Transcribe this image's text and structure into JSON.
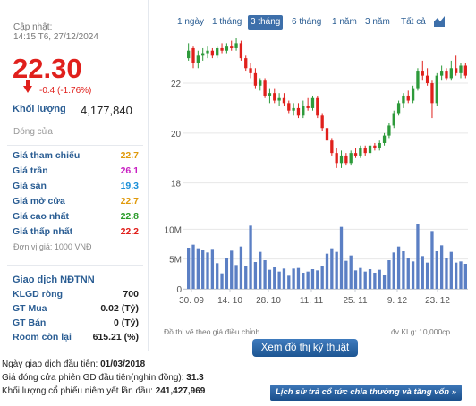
{
  "quote": {
    "updated_label": "Cập nhật:",
    "updated_time": "14:15 T6, 27/12/2024",
    "price": "22.30",
    "change": "-0.4 (-1.76%)",
    "volume_label": "Khối lượng",
    "volume_value": "4,177,840",
    "session_status": "Đóng cửa"
  },
  "price_levels": [
    {
      "label": "Giá tham chiếu",
      "value": "22.7",
      "color": "#e09a0c"
    },
    {
      "label": "Giá trần",
      "value": "26.1",
      "color": "#c81fc2"
    },
    {
      "label": "Giá sàn",
      "value": "19.3",
      "color": "#1a8fd8"
    },
    {
      "label": "Giá mở cửa",
      "value": "22.7",
      "color": "#e09a0c"
    },
    {
      "label": "Giá cao nhất",
      "value": "22.8",
      "color": "#2a9b2a"
    },
    {
      "label": "Giá thấp nhất",
      "value": "22.2",
      "color": "#e0201c"
    }
  ],
  "unit_note": "Đơn vị giá: 1000 VNĐ",
  "foreign": {
    "title": "Giao dịch NĐTNN",
    "rows": [
      {
        "label": "KLGD ròng",
        "value": "700"
      },
      {
        "label": "GT Mua",
        "value": "0.02 (Tỷ)"
      },
      {
        "label": "GT Bán",
        "value": "0 (Tỷ)"
      },
      {
        "label": "Room còn lại",
        "value": "615.21 (%)"
      }
    ]
  },
  "range_tabs": [
    {
      "label": "1 ngày",
      "active": false
    },
    {
      "label": "1 tháng",
      "active": false
    },
    {
      "label": "3 tháng",
      "active": true
    },
    {
      "label": "6 tháng",
      "active": false
    },
    {
      "label": "1 năm",
      "active": false
    },
    {
      "label": "3 năm",
      "active": false
    },
    {
      "label": "Tất cả",
      "active": false
    }
  ],
  "chart_type_icon": "area-chart-icon",
  "chart_data": {
    "type": "candlestick",
    "price_ticks": [
      "22",
      "20",
      "18"
    ],
    "price_range": [
      17.7,
      23.9
    ],
    "volume_ticks": [
      "10M",
      "5M",
      "0"
    ],
    "volume_range": [
      0,
      12
    ],
    "x_tick_labels": [
      "30. 09",
      "14. 10",
      "28. 10",
      "11. 11",
      "25. 11",
      "9. 12",
      "23. 12"
    ],
    "candles": [
      {
        "o": 23.0,
        "h": 23.6,
        "l": 22.9,
        "c": 23.3
      },
      {
        "o": 23.4,
        "h": 23.5,
        "l": 22.6,
        "c": 22.8
      },
      {
        "o": 22.8,
        "h": 23.3,
        "l": 22.6,
        "c": 23.1
      },
      {
        "o": 23.1,
        "h": 23.4,
        "l": 22.9,
        "c": 23.2
      },
      {
        "o": 23.2,
        "h": 23.5,
        "l": 23.0,
        "c": 23.3
      },
      {
        "o": 23.3,
        "h": 23.4,
        "l": 23.0,
        "c": 23.1
      },
      {
        "o": 23.1,
        "h": 23.5,
        "l": 23.0,
        "c": 23.4
      },
      {
        "o": 23.4,
        "h": 23.6,
        "l": 23.2,
        "c": 23.3
      },
      {
        "o": 23.3,
        "h": 23.6,
        "l": 23.2,
        "c": 23.5
      },
      {
        "o": 23.5,
        "h": 23.7,
        "l": 23.3,
        "c": 23.4
      },
      {
        "o": 23.4,
        "h": 23.8,
        "l": 23.3,
        "c": 23.6
      },
      {
        "o": 23.6,
        "h": 23.7,
        "l": 22.9,
        "c": 23.0
      },
      {
        "o": 23.0,
        "h": 23.1,
        "l": 22.5,
        "c": 22.6
      },
      {
        "o": 22.6,
        "h": 22.8,
        "l": 22.2,
        "c": 22.4
      },
      {
        "o": 22.4,
        "h": 22.6,
        "l": 21.8,
        "c": 21.9
      },
      {
        "o": 21.9,
        "h": 22.2,
        "l": 21.7,
        "c": 22.1
      },
      {
        "o": 22.1,
        "h": 22.2,
        "l": 21.4,
        "c": 21.5
      },
      {
        "o": 21.5,
        "h": 21.8,
        "l": 21.2,
        "c": 21.6
      },
      {
        "o": 21.6,
        "h": 21.8,
        "l": 21.2,
        "c": 21.3
      },
      {
        "o": 21.3,
        "h": 21.6,
        "l": 21.1,
        "c": 21.4
      },
      {
        "o": 21.4,
        "h": 21.6,
        "l": 21.1,
        "c": 21.2
      },
      {
        "o": 21.2,
        "h": 21.3,
        "l": 20.8,
        "c": 20.9
      },
      {
        "o": 20.9,
        "h": 21.2,
        "l": 20.7,
        "c": 21.0
      },
      {
        "o": 21.0,
        "h": 21.2,
        "l": 20.6,
        "c": 20.7
      },
      {
        "o": 20.7,
        "h": 21.3,
        "l": 20.6,
        "c": 21.1
      },
      {
        "o": 21.1,
        "h": 21.4,
        "l": 20.9,
        "c": 21.0
      },
      {
        "o": 21.0,
        "h": 21.5,
        "l": 20.9,
        "c": 21.4
      },
      {
        "o": 21.4,
        "h": 21.5,
        "l": 20.6,
        "c": 20.7
      },
      {
        "o": 20.7,
        "h": 20.8,
        "l": 20.1,
        "c": 20.2
      },
      {
        "o": 20.2,
        "h": 20.4,
        "l": 19.6,
        "c": 19.7
      },
      {
        "o": 19.7,
        "h": 19.8,
        "l": 19.1,
        "c": 19.2
      },
      {
        "o": 19.2,
        "h": 19.4,
        "l": 18.6,
        "c": 18.8
      },
      {
        "o": 18.8,
        "h": 19.3,
        "l": 18.6,
        "c": 19.1
      },
      {
        "o": 19.1,
        "h": 19.2,
        "l": 18.7,
        "c": 18.8
      },
      {
        "o": 18.8,
        "h": 19.3,
        "l": 18.7,
        "c": 19.2
      },
      {
        "o": 19.2,
        "h": 19.4,
        "l": 19.0,
        "c": 19.1
      },
      {
        "o": 19.1,
        "h": 19.5,
        "l": 19.0,
        "c": 19.4
      },
      {
        "o": 19.4,
        "h": 19.5,
        "l": 19.1,
        "c": 19.2
      },
      {
        "o": 19.2,
        "h": 19.6,
        "l": 19.1,
        "c": 19.5
      },
      {
        "o": 19.5,
        "h": 19.6,
        "l": 19.3,
        "c": 19.4
      },
      {
        "o": 19.4,
        "h": 19.7,
        "l": 19.3,
        "c": 19.6
      },
      {
        "o": 19.6,
        "h": 20.0,
        "l": 19.5,
        "c": 19.9
      },
      {
        "o": 19.9,
        "h": 20.4,
        "l": 19.8,
        "c": 20.3
      },
      {
        "o": 20.3,
        "h": 20.9,
        "l": 20.2,
        "c": 20.8
      },
      {
        "o": 20.8,
        "h": 21.3,
        "l": 20.7,
        "c": 21.2
      },
      {
        "o": 21.2,
        "h": 21.6,
        "l": 21.0,
        "c": 21.5
      },
      {
        "o": 21.5,
        "h": 21.7,
        "l": 21.2,
        "c": 21.3
      },
      {
        "o": 21.3,
        "h": 21.9,
        "l": 21.2,
        "c": 21.8
      },
      {
        "o": 21.8,
        "h": 22.6,
        "l": 21.7,
        "c": 22.5
      },
      {
        "o": 22.5,
        "h": 22.9,
        "l": 22.1,
        "c": 22.3
      },
      {
        "o": 22.3,
        "h": 22.6,
        "l": 21.9,
        "c": 22.0
      },
      {
        "o": 22.0,
        "h": 22.1,
        "l": 20.6,
        "c": 21.2
      },
      {
        "o": 21.2,
        "h": 22.4,
        "l": 21.1,
        "c": 22.3
      },
      {
        "o": 22.3,
        "h": 22.7,
        "l": 22.1,
        "c": 22.5
      },
      {
        "o": 22.5,
        "h": 22.6,
        "l": 22.1,
        "c": 22.2
      },
      {
        "o": 22.2,
        "h": 22.9,
        "l": 22.1,
        "c": 22.6
      },
      {
        "o": 22.6,
        "h": 23.1,
        "l": 22.3,
        "c": 22.4
      },
      {
        "o": 22.4,
        "h": 22.8,
        "l": 22.2,
        "c": 22.7
      },
      {
        "o": 22.7,
        "h": 22.8,
        "l": 22.2,
        "c": 22.3
      }
    ],
    "volumes": [
      6.9,
      7.4,
      6.8,
      6.6,
      6.1,
      6.7,
      4.3,
      2.6,
      5.1,
      6.4,
      4.0,
      7.1,
      3.9,
      10.6,
      4.5,
      6.2,
      4.8,
      3.2,
      3.6,
      2.9,
      3.4,
      2.2,
      3.4,
      3.5,
      2.7,
      2.9,
      3.3,
      3.1,
      3.9,
      5.9,
      6.8,
      6.2,
      10.4,
      4.7,
      5.6,
      3.1,
      3.5,
      2.9,
      3.3,
      2.7,
      3.2,
      2.4,
      4.8,
      6.1,
      7.1,
      6.3,
      5.1,
      4.6,
      10.9,
      5.5,
      4.4,
      9.7,
      6.3,
      7.3,
      5.1,
      6.2,
      4.4,
      4.6,
      4.2
    ],
    "candle_colors": {
      "up": "#2d9a3a",
      "down": "#e0201c"
    },
    "volume_color": "#5b7fc4"
  },
  "chart_notes": {
    "left": "Đồ thị vẽ theo giá điều chỉnh",
    "right": "đv KLg: 10,000cp"
  },
  "ta_button_label": "Xem đồ thị kỹ thuật",
  "listing": {
    "first_trade_label": "Ngày giao dịch đầu tiên: ",
    "first_trade_value": "01/03/2018",
    "first_close_label": "Giá đóng cửa phiên GD đầu tiên(nghìn đồng): ",
    "first_close_value": "31.3",
    "first_volume_label": "Khối lượng cổ phiếu niêm yết lần đầu: ",
    "first_volume_value": "241,427,969"
  },
  "history_button_label": "Lịch sử trả cổ tức chia thưởng và tăng vốn »"
}
